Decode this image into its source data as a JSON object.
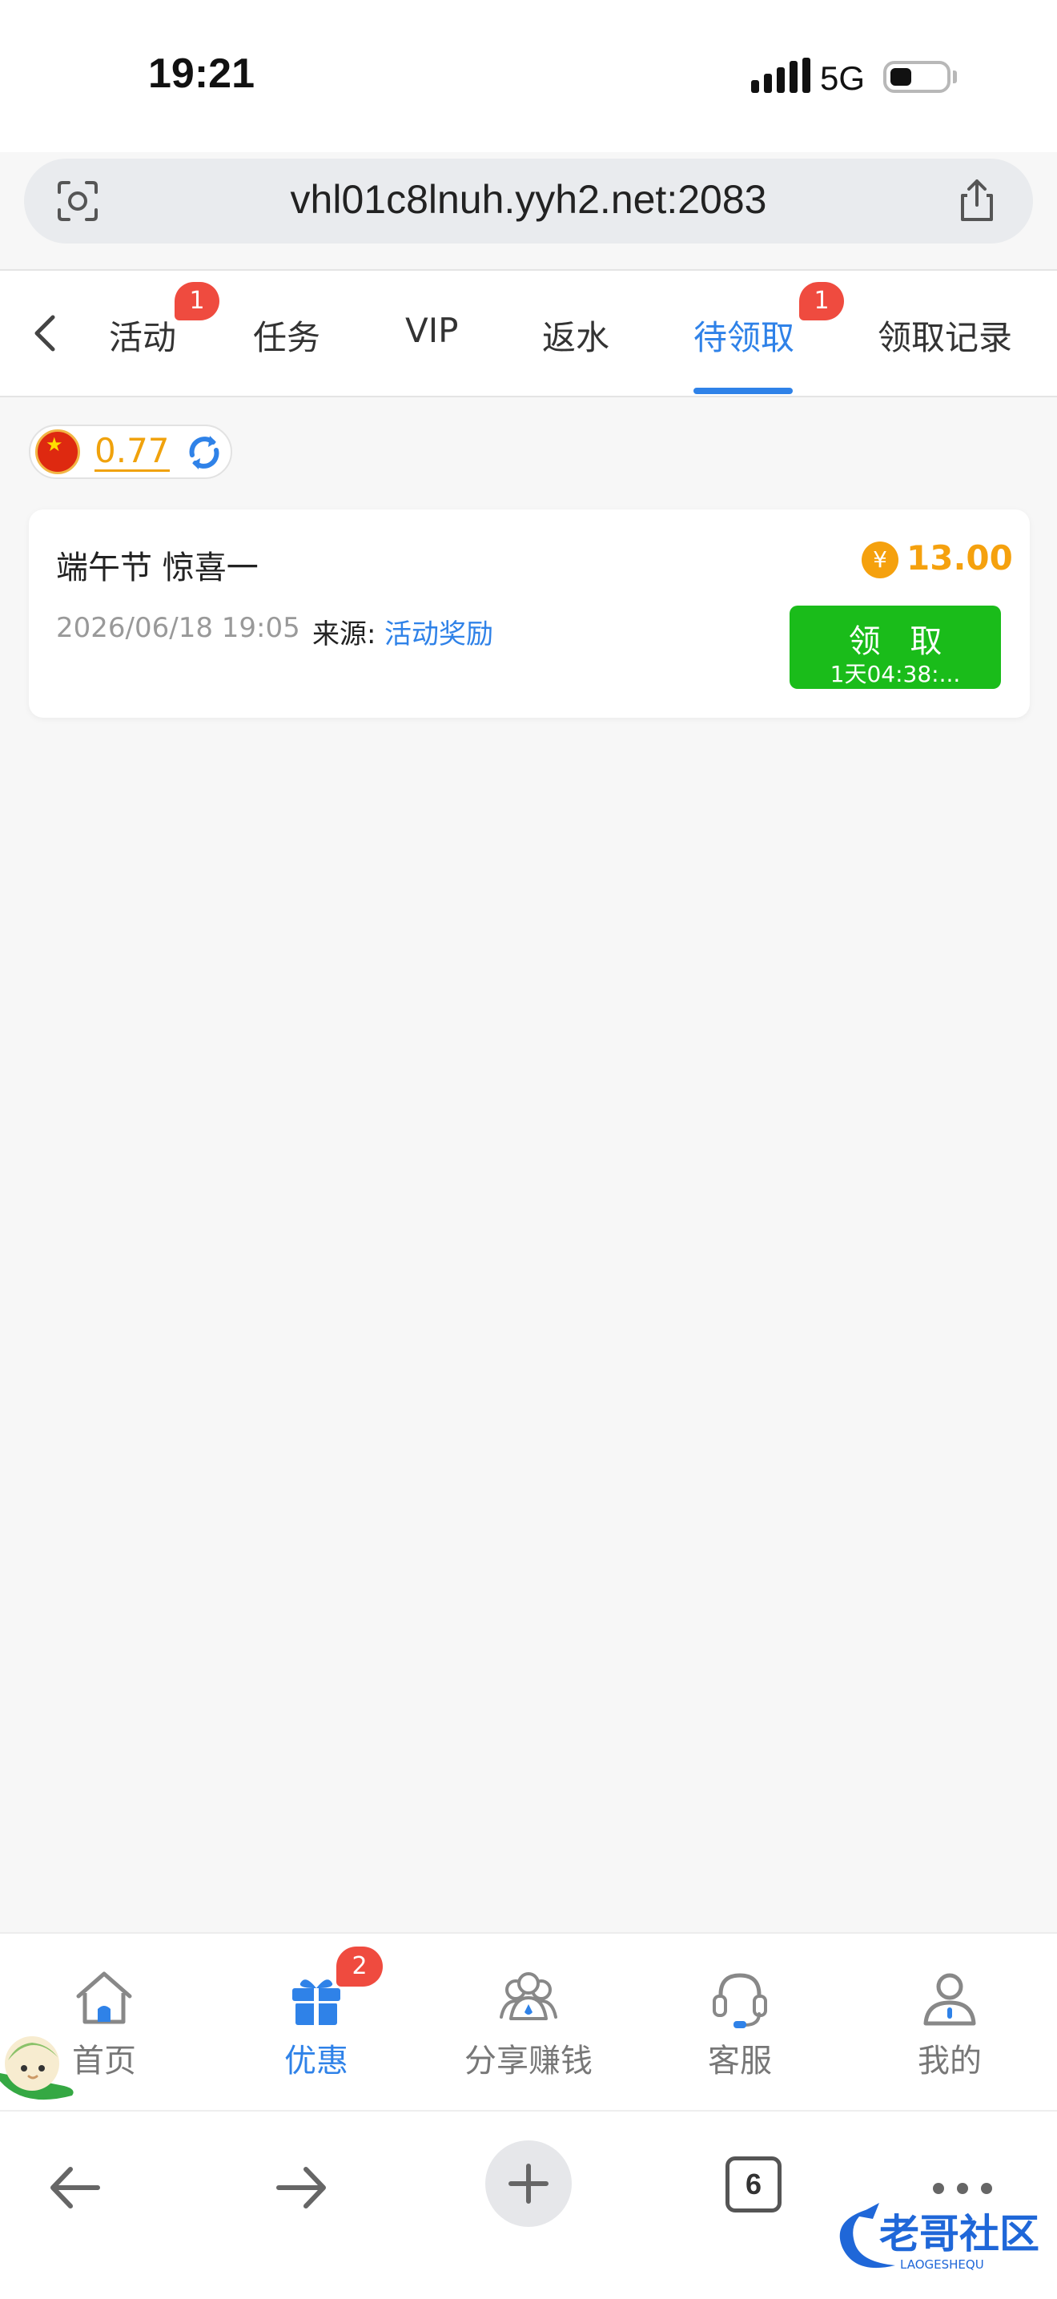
{
  "status_bar": {
    "time": "19:21",
    "network": "5G"
  },
  "url_bar": {
    "url": "vhl01c8lnuh.yyh2.net:2083"
  },
  "tabs": [
    {
      "label": "活动",
      "badge": "1",
      "active": false
    },
    {
      "label": "任务",
      "active": false
    },
    {
      "label": "VIP",
      "active": false
    },
    {
      "label": "返水",
      "active": false
    },
    {
      "label": "待领取",
      "badge": "1",
      "active": true
    },
    {
      "label": "领取记录",
      "active": false
    }
  ],
  "balance": {
    "value": "0.77"
  },
  "reward": {
    "title": "端午节 惊喜一",
    "amount": "13.00",
    "currency_symbol": "¥",
    "date": "2026/06/18 19:05",
    "source_label": "来源:",
    "source_value": "活动奖励",
    "claim_label": "领 取",
    "countdown": "1天04:38:..."
  },
  "bottom_nav": [
    {
      "label": "首页",
      "icon": "home-icon"
    },
    {
      "label": "优惠",
      "icon": "gift-icon",
      "badge": "2",
      "active": true
    },
    {
      "label": "分享赚钱",
      "icon": "share-earn-icon"
    },
    {
      "label": "客服",
      "icon": "headset-icon"
    },
    {
      "label": "我的",
      "icon": "profile-icon"
    }
  ],
  "browser_toolbar": {
    "tab_count": "6"
  },
  "colors": {
    "accent": "#2f82e8",
    "badge": "#ef4b3f",
    "amount": "#f5a10e",
    "claim_button": "#1abc1a"
  },
  "watermark": {
    "text": "老哥社区",
    "subtext": "LAOGESHEQU"
  }
}
